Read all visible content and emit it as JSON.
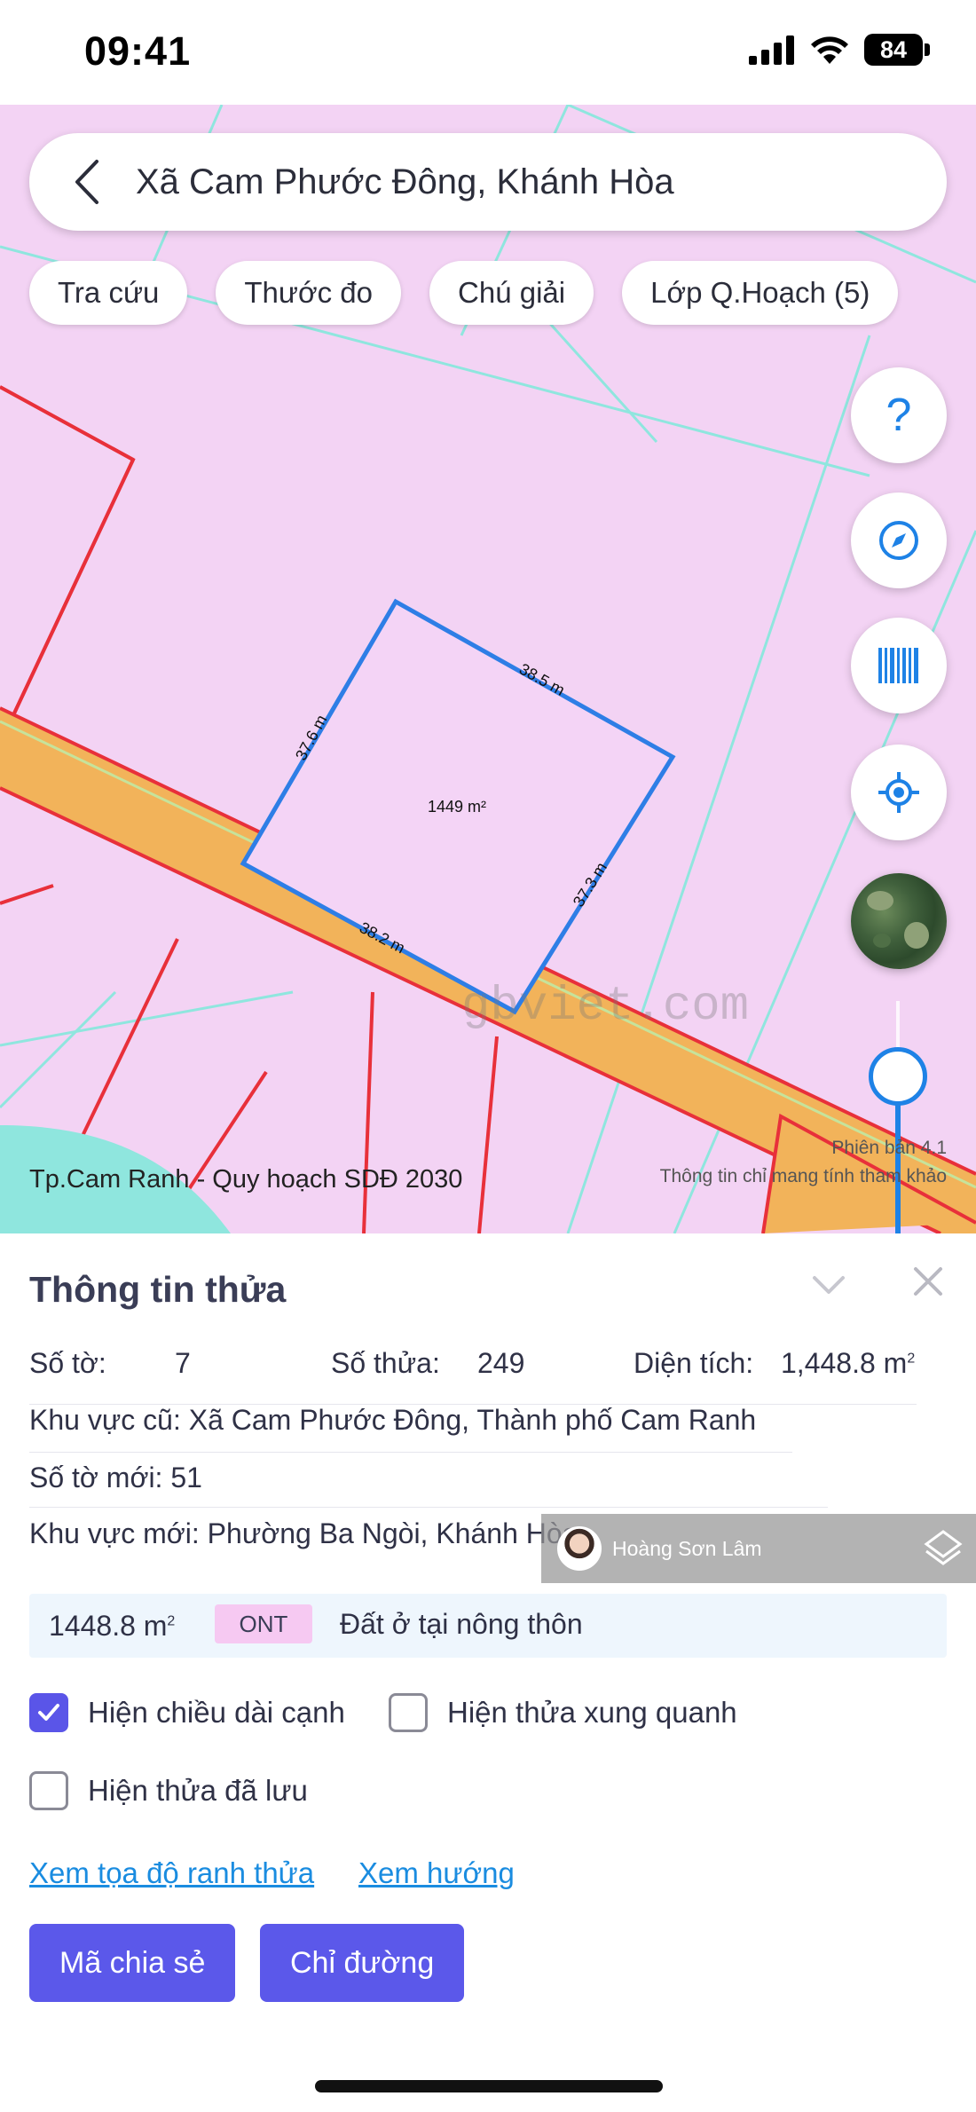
{
  "status_bar": {
    "time": "09:41",
    "battery": "84"
  },
  "search": {
    "location": "Xã Cam Phước Đông, Khánh Hòa"
  },
  "chips": [
    {
      "label": "Tra cứu"
    },
    {
      "label": "Thước đo"
    },
    {
      "label": "Chú giải"
    },
    {
      "label": "Lớp Q.Hoạch (5)"
    }
  ],
  "fab": {
    "help": "?"
  },
  "map": {
    "parcel_area_label": "1449 m²",
    "edges": [
      "38.5 m",
      "37.6 m",
      "37.3 m",
      "38.2 m"
    ],
    "watermark": "gbviet.com",
    "caption": "Tp.Cam Ranh - Quy hoạch SDĐ 2030",
    "version_line1": "Phiên bản 4.1",
    "version_line2": "Thông tin chỉ mang tính tham khảo",
    "colors": {
      "background": "#f3d3f4",
      "road": "#f2b35a",
      "parcel_outline": "#2e7ee6",
      "lot_line": "#e8303a",
      "grid_line": "#8fe6de"
    }
  },
  "sheet": {
    "title": "Thông tin thửa",
    "so_to_label": "Số tờ:",
    "so_to_value": "7",
    "so_thua_label": "Số thửa:",
    "so_thua_value": "249",
    "dien_tich_label": "Diện tích:",
    "dien_tich_value": "1,448.8 m",
    "khu_vuc_cu": "Khu vực cũ: Xã Cam Phước Đông, Thành phố Cam Ranh",
    "so_to_moi": "Số tờ mới: 51",
    "khu_vuc_moi": "Khu vực mới: Phường Ba Ngòi, Khánh Hòa",
    "area_value": "1448.8 m",
    "land_code": "ONT",
    "land_type": "Đất ở tại nông thôn",
    "check_show_edges": "Hiện chiều dài cạnh",
    "check_show_neighbors": "Hiện thửa xung quanh",
    "check_show_saved": "Hiện thửa đã lưu",
    "link_coords": "Xem tọa độ ranh thửa",
    "link_direction": "Xem hướng",
    "btn_share": "Mã chia sẻ",
    "btn_directions": "Chỉ đường",
    "accent_color": "#5b58ea"
  },
  "overlay": {
    "name": "Hoàng Sơn Lâm"
  }
}
